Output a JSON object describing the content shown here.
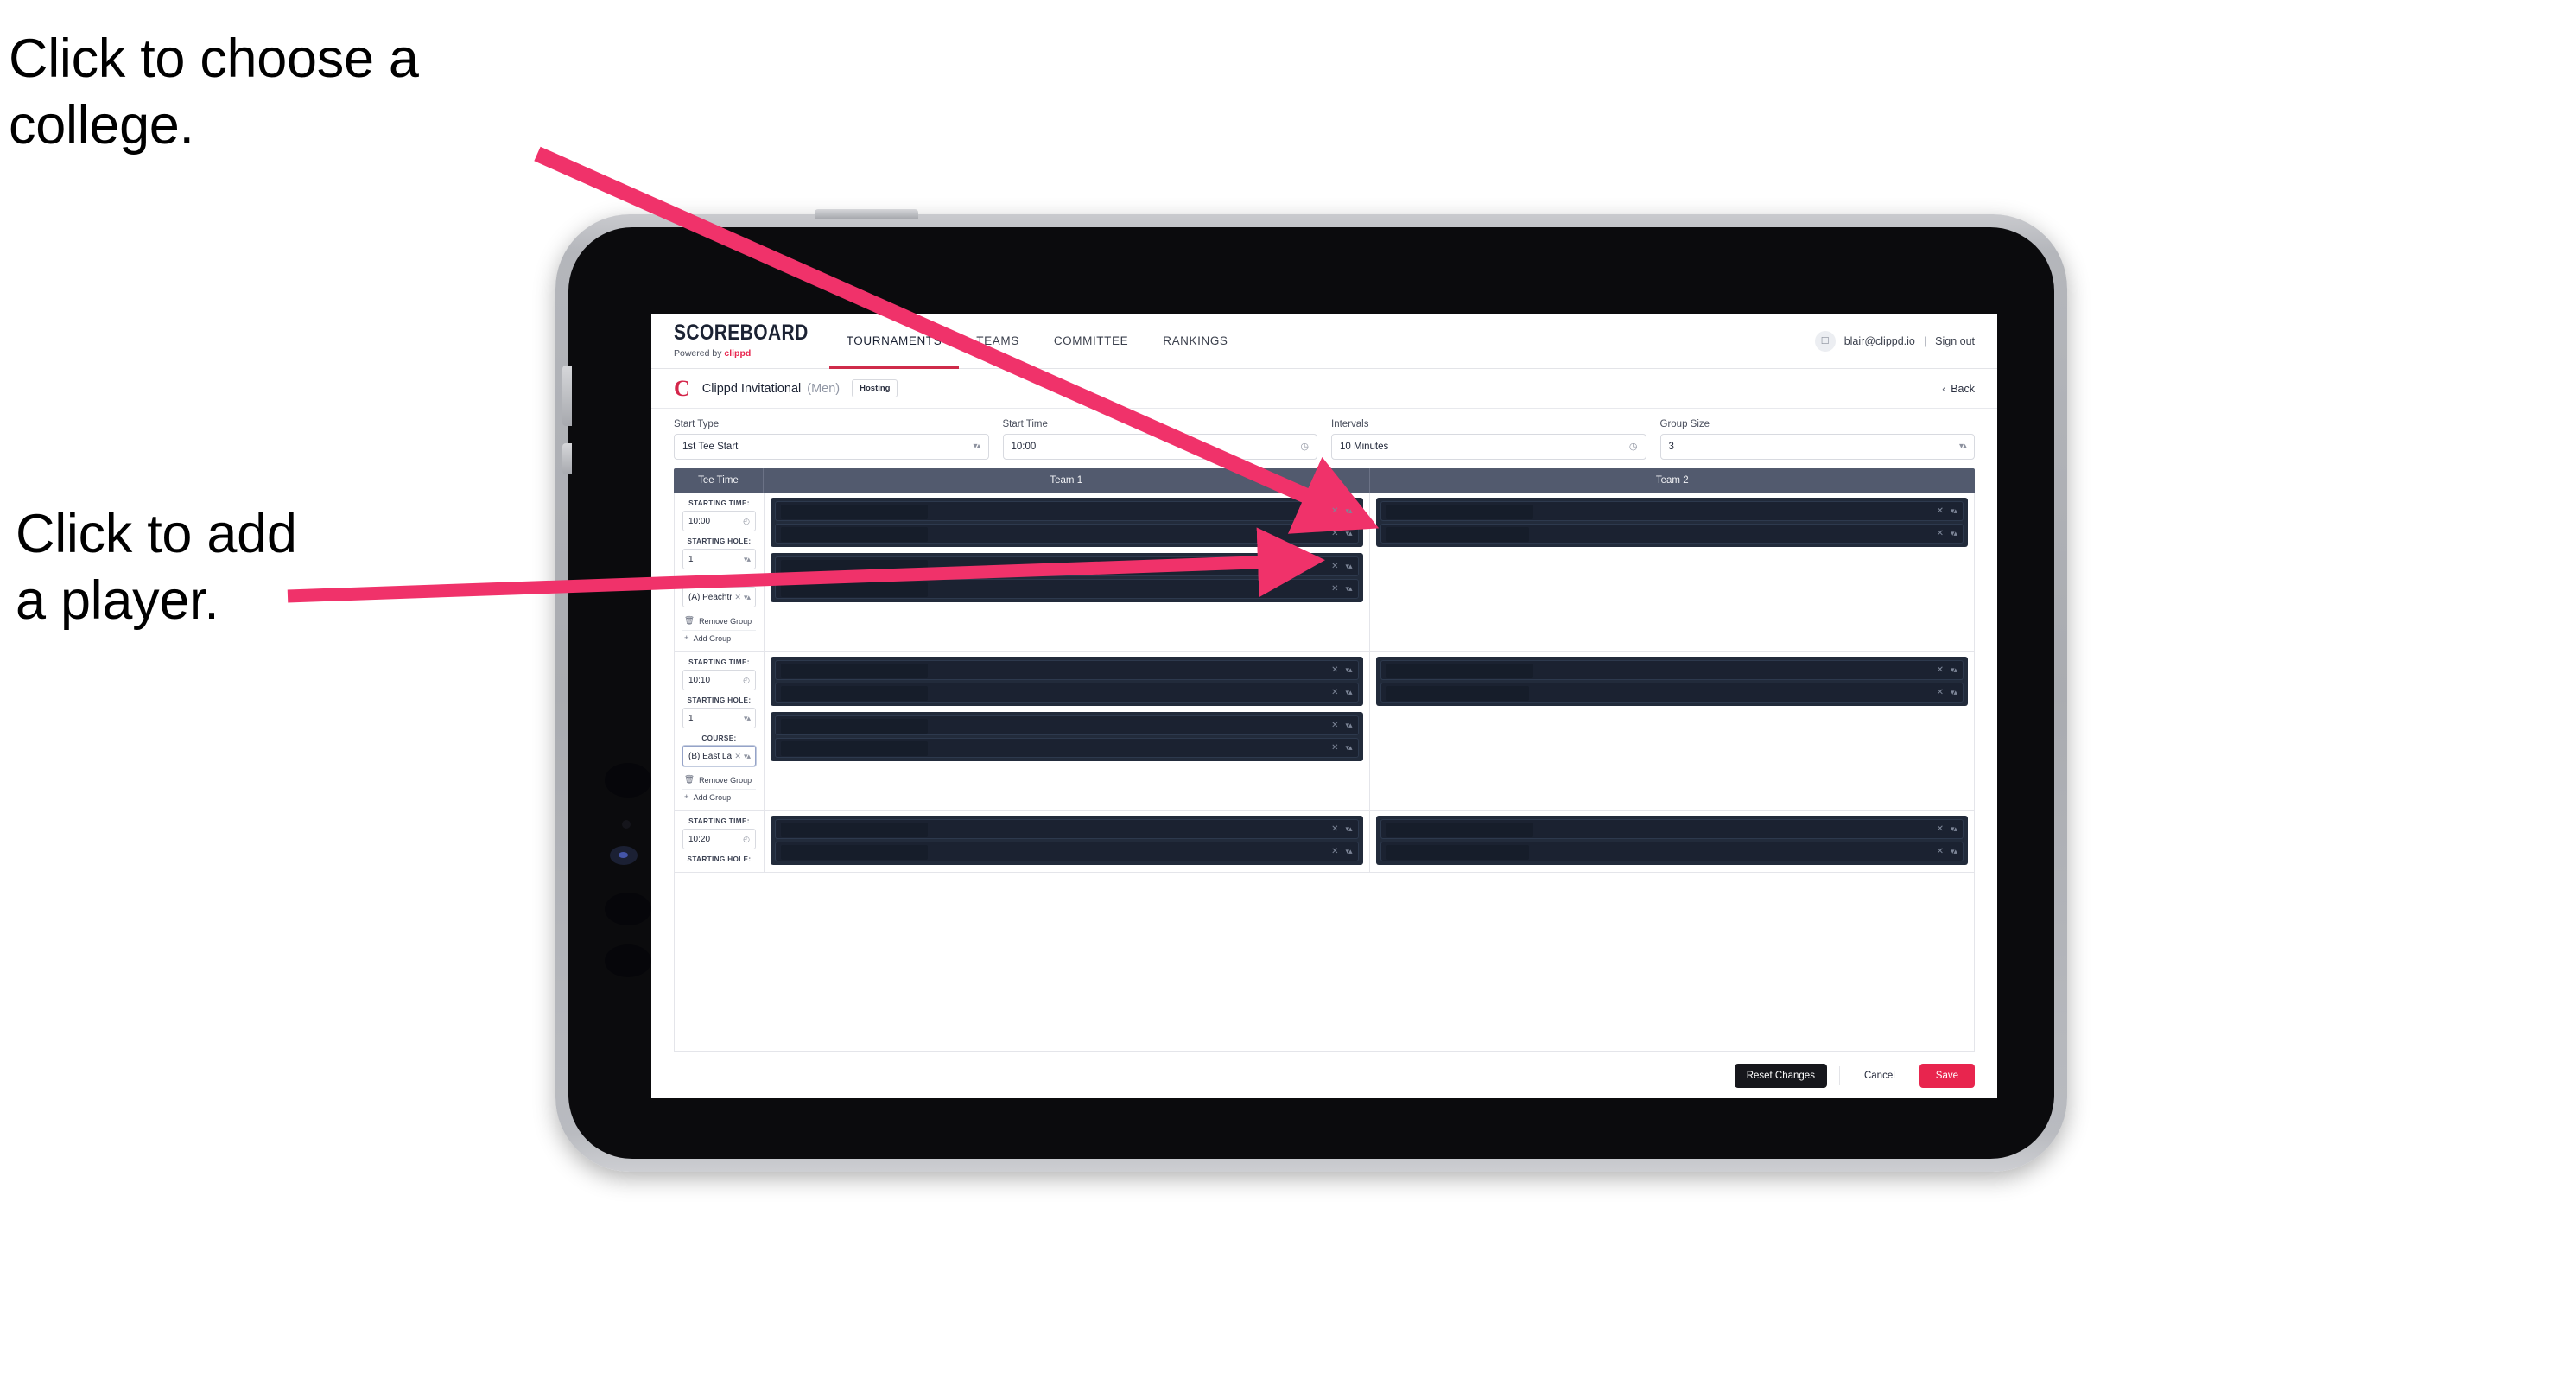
{
  "annotations": {
    "college": "Click to choose a\ncollege.",
    "player": "Click to add\na player."
  },
  "colors": {
    "accent": "#e8254e",
    "nav_active_underline": "#cf2b4a",
    "table_header_bg": "#525a6e",
    "slot_bg": "#222b3b",
    "brand_red": "#d4264a"
  },
  "topbar": {
    "brand_word": "SCOREBOARD",
    "brand_sub_prefix": "Powered by",
    "brand_sub_name": "clippd",
    "nav": [
      {
        "label": "TOURNAMENTS",
        "active": true
      },
      {
        "label": "TEAMS",
        "active": false
      },
      {
        "label": "COMMITTEE",
        "active": false
      },
      {
        "label": "RANKINGS",
        "active": false
      }
    ],
    "avatar_icon": "user-avatar-icon",
    "user_email": "blair@clippd.io",
    "separator": "|",
    "sign_out": "Sign out"
  },
  "tournament": {
    "logo_letter": "C",
    "name": "Clippd Invitational",
    "gender": "(Men)",
    "badge": "Hosting",
    "back_chevron": "‹",
    "back_label": "Back"
  },
  "settings": {
    "fields": [
      {
        "label": "Start Type",
        "value": "1st Tee Start",
        "icon": "stepper-icon"
      },
      {
        "label": "Start Time",
        "value": "10:00",
        "icon": "clock-icon"
      },
      {
        "label": "Intervals",
        "value": "10 Minutes",
        "icon": "clock-icon"
      },
      {
        "label": "Group Size",
        "value": "3",
        "icon": "stepper-icon"
      }
    ]
  },
  "table": {
    "headers": [
      "Tee Time",
      "Team 1",
      "Team 2"
    ],
    "labels": {
      "starting_time": "STARTING TIME:",
      "starting_hole": "STARTING HOLE:",
      "course": "COURSE:",
      "remove_group": "Remove Group",
      "add_group": "Add Group",
      "remove_icon": "trash-icon",
      "add_icon": "plus-icon",
      "clock_icon": "clock-icon",
      "stepper_icon": "stepper-icon",
      "clear_icon": "clear-x-icon"
    },
    "rows": [
      {
        "starting_time": "10:00",
        "starting_hole": "1",
        "course": "(A) Peachtree GC",
        "course_focused": false,
        "team1_groups": [
          {
            "slots": [
              {
                "redact_width": 170
              },
              {
                "redact_width": 170
              }
            ]
          },
          {
            "slots": [
              {
                "redact_width": 170
              },
              {
                "redact_width": 170
              }
            ]
          }
        ],
        "team2_groups": [
          {
            "slots": [
              {
                "redact_width": 170
              },
              {
                "redact_width": 165
              }
            ]
          }
        ]
      },
      {
        "starting_time": "10:10",
        "starting_hole": "1",
        "course": "(B) East Lake GC",
        "course_focused": true,
        "team1_groups": [
          {
            "slots": [
              {
                "redact_width": 170
              },
              {
                "redact_width": 170
              }
            ]
          },
          {
            "slots": [
              {
                "redact_width": 170
              },
              {
                "redact_width": 170
              }
            ]
          }
        ],
        "team2_groups": [
          {
            "slots": [
              {
                "redact_width": 170
              },
              {
                "redact_width": 165
              }
            ]
          }
        ]
      },
      {
        "starting_time": "10:20",
        "starting_hole": "",
        "course": "",
        "course_focused": false,
        "team1_groups": [
          {
            "slots": [
              {
                "redact_width": 170
              },
              {
                "redact_width": 170
              }
            ]
          }
        ],
        "team2_groups": [
          {
            "slots": [
              {
                "redact_width": 170
              },
              {
                "redact_width": 165
              }
            ]
          }
        ]
      }
    ]
  },
  "footer": {
    "reset": "Reset Changes",
    "cancel": "Cancel",
    "save": "Save"
  }
}
